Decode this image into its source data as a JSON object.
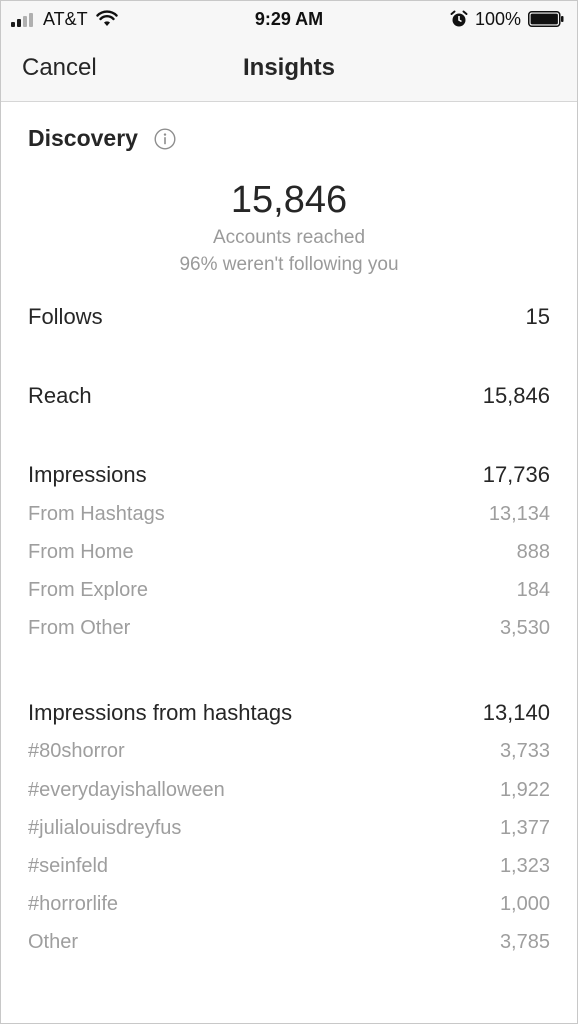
{
  "status_bar": {
    "carrier": "AT&T",
    "time": "9:29 AM",
    "battery_percent": "100%"
  },
  "nav": {
    "cancel_label": "Cancel",
    "title": "Insights"
  },
  "discovery": {
    "title": "Discovery",
    "info_icon": "info-circle-icon",
    "accounts_reached_value": "15,846",
    "accounts_reached_label": "Accounts reached",
    "not_following_text": "96% weren't following you"
  },
  "metrics": {
    "follows": {
      "label": "Follows",
      "value": "15"
    },
    "reach": {
      "label": "Reach",
      "value": "15,846"
    },
    "impressions": {
      "label": "Impressions",
      "value": "17,736",
      "breakdown": [
        {
          "label": "From Hashtags",
          "value": "13,134"
        },
        {
          "label": "From Home",
          "value": "888"
        },
        {
          "label": "From Explore",
          "value": "184"
        },
        {
          "label": "From Other",
          "value": "3,530"
        }
      ]
    },
    "hashtag_impressions": {
      "label": "Impressions from hashtags",
      "value": "13,140",
      "breakdown": [
        {
          "label": "#80shorror",
          "value": "3,733"
        },
        {
          "label": "#everydayishalloween",
          "value": "1,922"
        },
        {
          "label": "#julialouisdreyfus",
          "value": "1,377"
        },
        {
          "label": "#seinfeld",
          "value": "1,323"
        },
        {
          "label": "#horrorlife",
          "value": "1,000"
        },
        {
          "label": "Other",
          "value": "3,785"
        }
      ]
    }
  },
  "colors": {
    "primary_text": "#262626",
    "secondary_text": "#9e9e9e",
    "bar_background": "#f7f7f7"
  }
}
